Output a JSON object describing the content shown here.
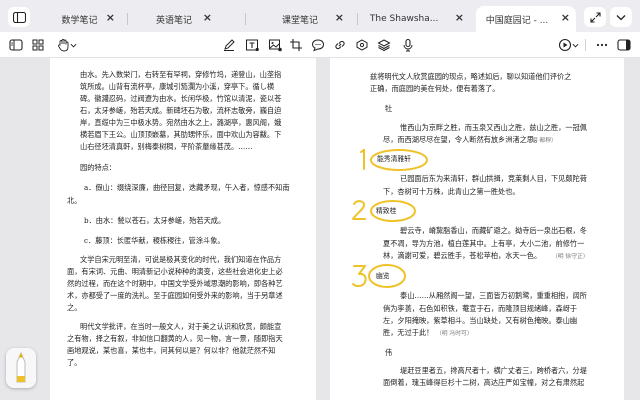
{
  "tabs": [
    {
      "label": "数学笔记"
    },
    {
      "label": "英语笔记"
    },
    {
      "label": "课堂笔记"
    },
    {
      "label": "The Shawsha..."
    },
    {
      "label": "中国庭园记 - ..."
    }
  ],
  "left_page": {
    "lines": [
      "由水。先入数栄门，右转至有罕祠，穿修竹坞，递登山，山垄指",
      "筑所成。山背有流杯亭，康城引笳瀾为小溪，穿亭下。循し横",
      "碑。徽濺忍码，过阀遼为由水。长闲华极，竹馆以清泥，瓷以苍",
      "石，太牙参嵯，殆若天成。新碑坯石为敬，流杯志敬旁，巍自迫",
      "岸，直缆中为三中极水势。宛然由水之上，潞湖亭，惠风阁，娥",
      "横若眉下王公。山顶顶嵌墓，其肋甥怀乐，面中欢山为容黻。下",
      "山右径坯清真軒，别梅泰树稠，平阶茶蘼缘甚茂。……",
      "园的特点：",
      "a．假山：缀绕深廉，曲径回复，迭藏矛现，午入者，惊感不知南",
      "北。",
      "b．由水：甃以苍石，太牙参嵯，殆若天成。",
      "c．藤顶：长匿华献，稷栋稷往，管涂斗象。",
      "文学自宋元明至清，可说是极其变化的时代，我们知道在作品方",
      "面，有宋词、元曲、明清新记小说种种的演变，这些社会进化史上必",
      "然的过程，而在这个时期中，中国文学受外域思潮的影响，即各种艺",
      "术，亦都受了一度的洗礼。至于庭园如何受外来的影响，当于另章述",
      "之。",
      "明代文学批评，在当时一般文人，对于美之认识和欣赏，颇能宣",
      "之有物，择之有叙，非如信口翻黄的人，见一物，言一景，随即指天",
      "画地观说，某也喜，某也丰，问其何以是？何以非？他就茫然不知",
      "了。"
    ]
  },
  "right_page": {
    "lines": [
      "兹将明代文人欣赏庭园的现点，略述如后，聊以知道他们评价之",
      "正确，而庭园的美在何处，便有着落了。",
      "牡",
      "惟西山为京畔之胜，而玉泉又西山之胜，兹山之胜，一冠佩",
      "尽，而西湖尽尽在望，令人断然有放乡洲渚之思。",
      "已园面后东为来清轩，群山拱揖，竞莱剩人目，下见颇陀荷",
      "下，杏树可十万株，此青山之第一胜处也。",
      "碧云寺，嵴黧脂香山，而藏矿避之。拗寺后一泉出石根，冬",
      "夏不凋，导为方池，植白莲其中。上有亭，大小二池，前修竹一",
      "林，滴謝可爱，碧云胜手，苍松苹柏，水天一色。",
      "泰山……从厢然阁一望，三面皆万初鹅鹭，重重相抱，阔所",
      "俏为孪蒉，石色如积铁，菴宣于石，而隆顶目规绪峰，森岈于",
      "左，夕阳掩映，紫草相斗。当山缺处，又有树色掩映。泰山幽",
      "胜，无过于此！",
      "伟",
      "堤赶豆里者五，搀高尺者十，横广丈者三，跨桥者六，分堤",
      "面倒着，瑰玉峰得巨杉十二树，高达庄严如宝幢，对之有肃然起"
    ],
    "notes": {
      "n1": "（明 都穆）",
      "n2": "（明 徐守正）",
      "n3": "（明 冯时可）"
    },
    "annotations": [
      {
        "number": "1",
        "label": "能秀清雅轩"
      },
      {
        "number": "2",
        "label": "精致桂"
      },
      {
        "number": "3",
        "label": "幽览"
      }
    ]
  },
  "colors": {
    "ink": "#f0c22a",
    "accent": "#e4b400",
    "tabbar": "#ececf1"
  }
}
